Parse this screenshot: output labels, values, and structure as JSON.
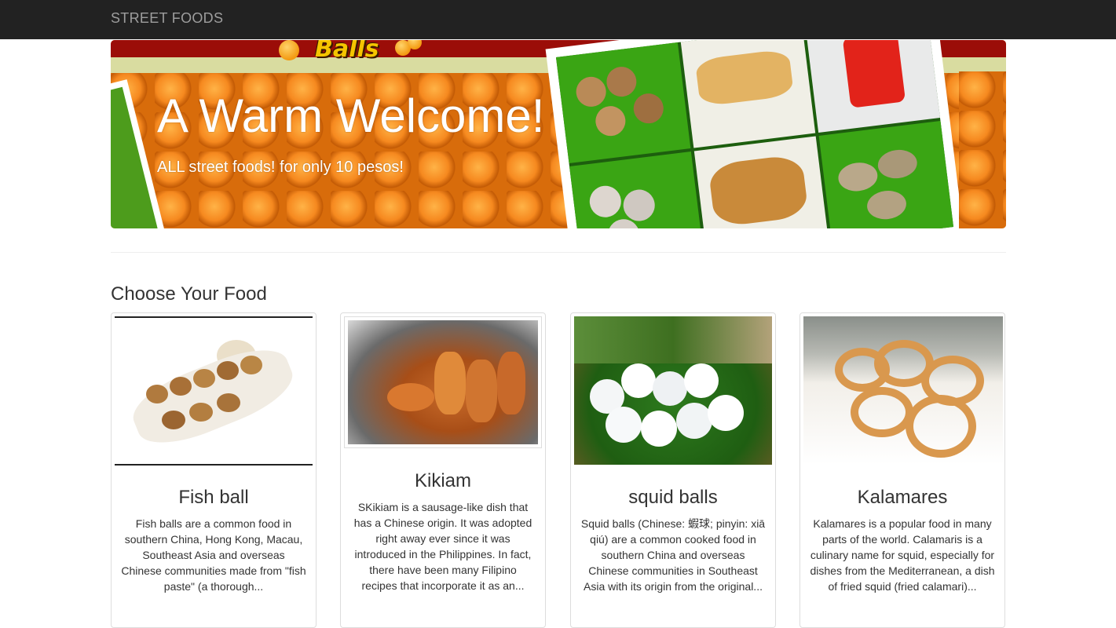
{
  "navbar": {
    "brand": "STREET FOODS"
  },
  "hero": {
    "logo_text": "Balls",
    "title": "A Warm Welcome!",
    "subtitle": "ALL street foods! for only 10 pesos!"
  },
  "section": {
    "title": "Choose Your Food"
  },
  "cards": [
    {
      "title": "Fish ball",
      "text": "Fish balls are a common food in southern China, Hong Kong, Macau, Southeast Asia and overseas Chinese communities made from \"fish paste\" (a thorough..."
    },
    {
      "title": "Kikiam",
      "text": "SKikiam is a sausage-like dish that has a Chinese origin. It was adopted right away ever since it was introduced in the Philippines. In fact, there have been many Filipino recipes that incorporate it as an..."
    },
    {
      "title": "squid balls",
      "text": "Squid balls (Chinese: 蝦球; pinyin: xiā qiú) are a common cooked food in southern China and overseas Chinese communities in Southeast Asia with its origin from the original..."
    },
    {
      "title": "Kalamares",
      "text": "Kalamares is a popular food in many parts of the world. Calamaris is a culinary name for squid, especially for dishes from the Mediterranean, a dish of fried squid (fried calamari)..."
    }
  ]
}
